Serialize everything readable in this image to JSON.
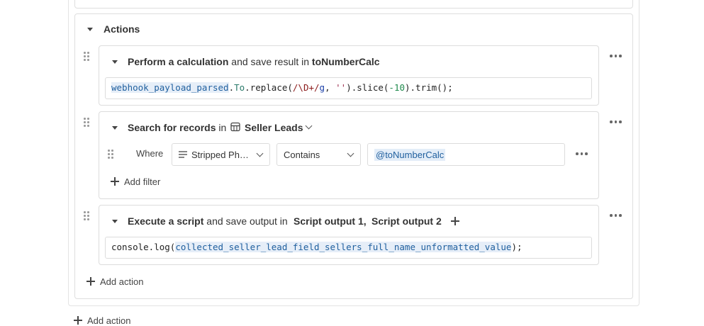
{
  "actions_section": {
    "title": "Actions"
  },
  "calculation_action": {
    "heading_bold": "Perform a calculation",
    "heading_mid": "and save result in",
    "heading_target": "toNumberCalc",
    "code": {
      "var": "webhook_payload_parsed",
      "dot1": ".",
      "prop": "To",
      "call1": ".replace(",
      "re_open": "/\\D+/",
      "re_flag": "g",
      "comma": ", ",
      "str": "''",
      "call2": ").slice(",
      "num": "-10",
      "call3": ").trim();"
    }
  },
  "search_action": {
    "heading_bold": "Search for records",
    "heading_mid": "in",
    "table_name": "Seller Leads",
    "filter": {
      "where_label": "Where",
      "field": "Stripped Ph…",
      "operator": "Contains",
      "value": "@toNumberCalc"
    },
    "add_filter_label": "Add filter"
  },
  "script_action": {
    "heading_bold": "Execute a script",
    "heading_mid": "and save output in",
    "output1": "Script output 1,",
    "output2": "Script output 2",
    "code": {
      "prefix": "console.log(",
      "var": "collected_seller_lead_field_sellers_full_name_unformatted_value",
      "suffix": ");"
    }
  },
  "add_action_label": "Add action",
  "bottom_cut_label": "Add action"
}
